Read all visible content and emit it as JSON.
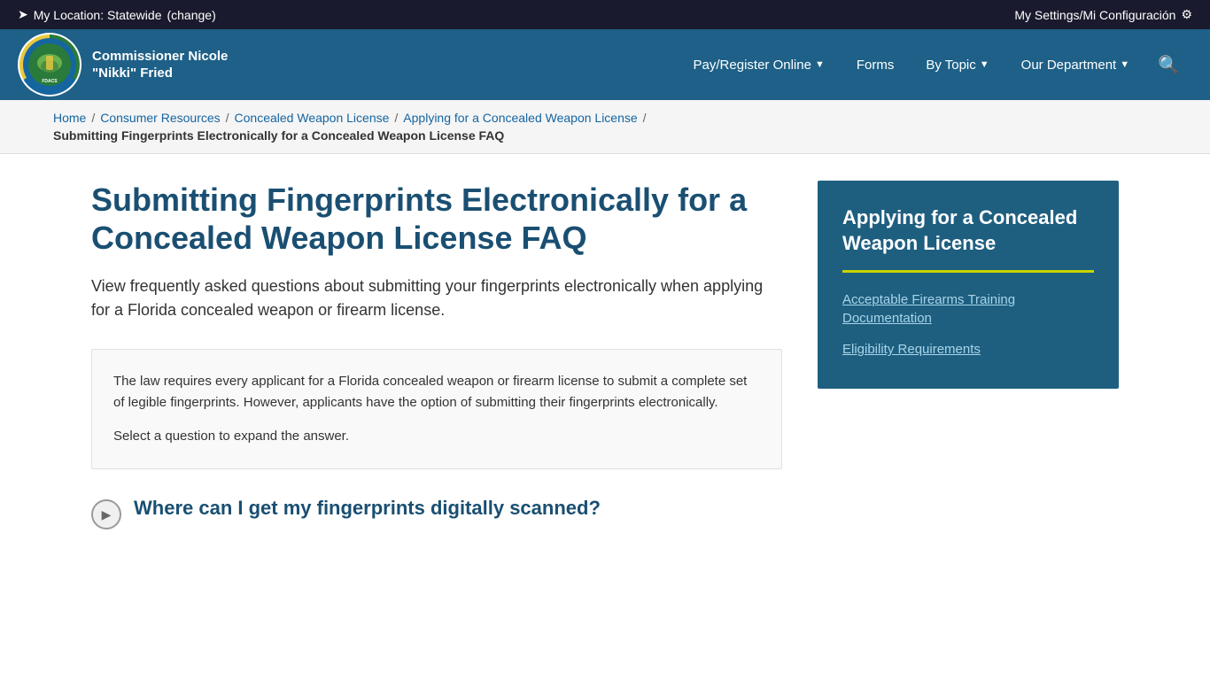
{
  "topbar": {
    "location_label": "My Location: Statewide",
    "change_label": "(change)",
    "settings_label": "My Settings/Mi Configuración",
    "arrow_icon": "➤"
  },
  "nav": {
    "commissioner": "Commissioner Nicole \"Nikki\" Fried",
    "links": [
      {
        "label": "Pay/Register Online",
        "has_dropdown": true
      },
      {
        "label": "Forms",
        "has_dropdown": false
      },
      {
        "label": "By Topic",
        "has_dropdown": true
      },
      {
        "label": "Our Department",
        "has_dropdown": true
      }
    ],
    "search_icon": "🔍"
  },
  "breadcrumb": {
    "items": [
      {
        "label": "Home",
        "href": "#"
      },
      {
        "label": "Consumer Resources",
        "href": "#"
      },
      {
        "label": "Concealed Weapon License",
        "href": "#"
      },
      {
        "label": "Applying for a Concealed Weapon License",
        "href": "#"
      }
    ],
    "current": "Submitting Fingerprints Electronically for a Concealed Weapon License FAQ"
  },
  "page": {
    "title": "Submitting Fingerprints Electronically for a Concealed Weapon License FAQ",
    "subtitle": "View frequently asked questions about submitting your fingerprints electronically when applying for a Florida concealed weapon or firearm license.",
    "body_p1": "The law requires every applicant for a Florida concealed weapon or firearm license to submit a complete set of legible fingerprints. However, applicants have the option of submitting their fingerprints electronically.",
    "body_p2": "Select a question to expand the answer.",
    "faq_q1": "Where can I get my fingerprints digitally scanned?"
  },
  "sidebar": {
    "title": "Applying for a Concealed Weapon License",
    "links": [
      {
        "label": "Acceptable Firearms Training Documentation"
      },
      {
        "label": "Eligibility Requirements"
      }
    ]
  }
}
